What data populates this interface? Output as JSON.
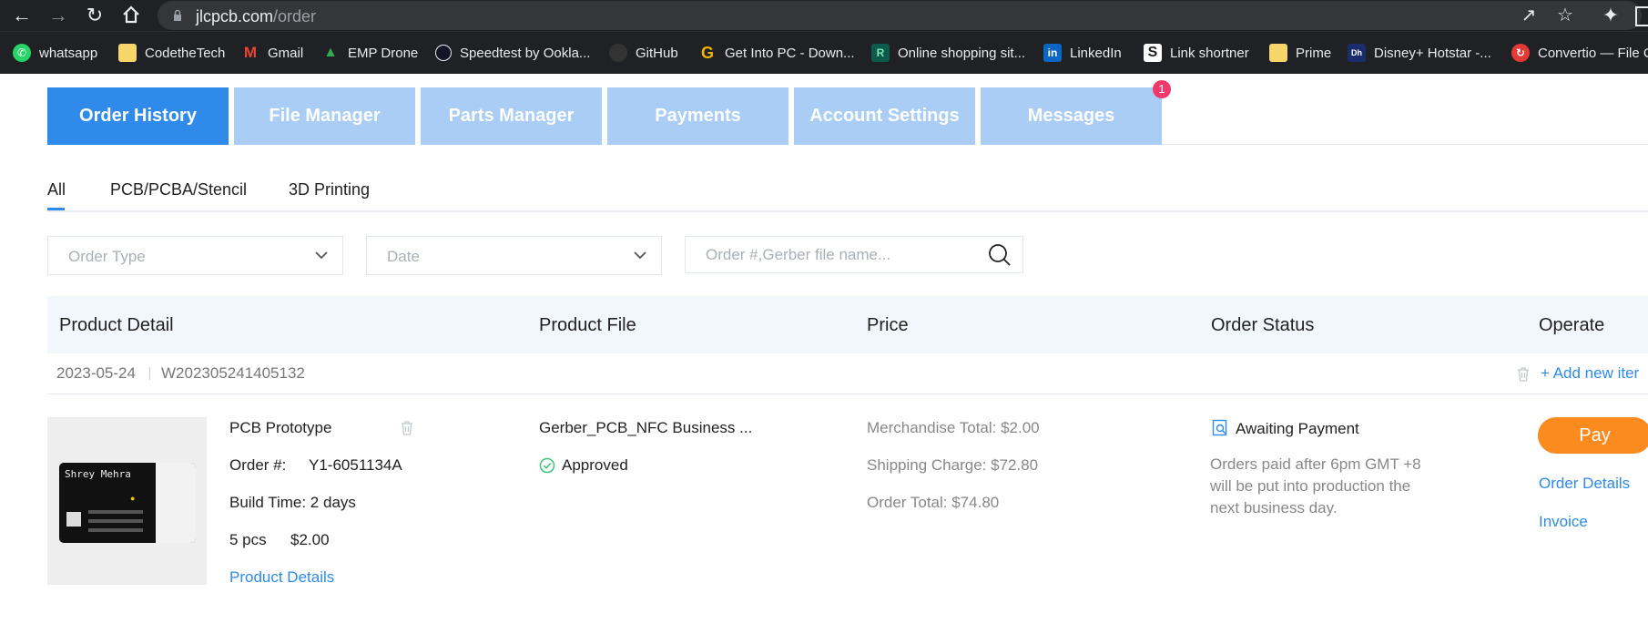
{
  "browser": {
    "url_host": "jlcpcb.com",
    "url_path": "/order"
  },
  "bookmarks": [
    {
      "label": "whatsapp",
      "icon": "whatsapp-icon",
      "color": "#25d366"
    },
    {
      "label": "CodetheTech",
      "icon": "folder-icon",
      "color": "#f6d56a"
    },
    {
      "label": "Gmail",
      "icon": "gmail-icon",
      "color": "#ea4335"
    },
    {
      "label": "EMP Drone",
      "icon": "google-drive-icon",
      "color": "#34a853"
    },
    {
      "label": "Speedtest by Ookla...",
      "icon": "speedtest-icon",
      "color": "#141526"
    },
    {
      "label": "GitHub",
      "icon": "github-icon",
      "color": "#333333"
    },
    {
      "label": "Get Into PC - Down...",
      "icon": "getintopc-icon",
      "color": "#f4b400"
    },
    {
      "label": "Online shopping sit...",
      "icon": "shopping-icon",
      "color": "#0b5a4a"
    },
    {
      "label": "LinkedIn",
      "icon": "linkedin-icon",
      "color": "#0a66c2"
    },
    {
      "label": "Link shortner",
      "icon": "link-shortener-icon",
      "color": "#ffffff"
    },
    {
      "label": "Prime",
      "icon": "folder-icon",
      "color": "#f6d56a"
    },
    {
      "label": "Disney+ Hotstar -...",
      "icon": "hotstar-icon",
      "color": "#1a2c6b"
    },
    {
      "label": "Convertio — File C",
      "icon": "convertio-icon",
      "color": "#e53935"
    }
  ],
  "tabs": [
    {
      "label": "Order History",
      "active": true
    },
    {
      "label": "File Manager",
      "active": false
    },
    {
      "label": "Parts Manager",
      "active": false
    },
    {
      "label": "Payments",
      "active": false
    },
    {
      "label": "Account Settings",
      "active": false
    },
    {
      "label": "Messages",
      "active": false,
      "badge": "1"
    }
  ],
  "subtabs": [
    {
      "label": "All",
      "active": true
    },
    {
      "label": "PCB/PCBA/Stencil",
      "active": false
    },
    {
      "label": "3D Printing",
      "active": false
    }
  ],
  "filters": {
    "order_type_placeholder": "Order Type",
    "date_placeholder": "Date",
    "search_placeholder": "Order #,Gerber file name..."
  },
  "table": {
    "headers": [
      "Product Detail",
      "Product File",
      "Price",
      "Order Status",
      "Operate"
    ]
  },
  "order": {
    "date": "2023-05-24",
    "group_id": "W202305241405132",
    "add_new_item": "+ Add new iter",
    "product_name": "PCB Prototype",
    "card_name": "Shrey Mehra",
    "order_no_label": "Order #:",
    "order_no": "Y1-6051134A",
    "build_time": "Build Time: 2 days",
    "qty": "5 pcs",
    "item_price": "$2.00",
    "product_details_link": "Product Details",
    "file_name": "Gerber_PCB_NFC Business ...",
    "file_status": "Approved",
    "merchandise_total": "Merchandise Total: $2.00",
    "shipping_charge": "Shipping Charge: $72.80",
    "order_total": "Order Total: $74.80",
    "status": "Awaiting Payment",
    "status_note": "Orders paid after 6pm GMT +8 will be put into production the next business day.",
    "pay_label": "Pay",
    "order_details_link": "Order Details",
    "invoice_link": "Invoice"
  },
  "colors": {
    "accent": "#2f8ae9",
    "tab_inactive": "#a9cdf5",
    "pay": "#fb8a1f",
    "approved": "#3cc47c",
    "badge": "#f0386b"
  }
}
